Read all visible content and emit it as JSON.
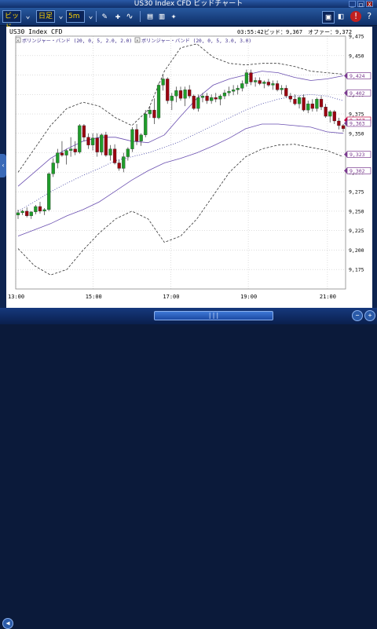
{
  "window": {
    "title": "US30 Index CFD ビッドチャート",
    "minimize": "_",
    "maximize": "□",
    "close": "X"
  },
  "toolbar": {
    "price_type": "ビッド",
    "chart_type": "日足",
    "timeframe": "5m",
    "icons": [
      "pen-icon",
      "pin-icon",
      "magnet-icon",
      "print-icon",
      "bar-chart-icon",
      "sparkle-icon"
    ],
    "right_icons": [
      "monitor-icon",
      "indicator-icon",
      "alert-icon",
      "help-icon"
    ]
  },
  "chart_header": {
    "symbol": "US30 Index CFD",
    "time": "03:55:42",
    "bid_label": "ビッド：9,367",
    "offer_label": "オファー：9,372"
  },
  "indicators": [
    {
      "label": "ボリンジャー・バンド (20, 0, 5, 2.0, 2.0)"
    },
    {
      "label": "ボリンジャー・バンド (20, 0, 5, 3.0, 3.0)"
    }
  ],
  "chart_data": {
    "type": "candlestick",
    "title": "US30 Index CFD",
    "y_ticks": [
      "9,475",
      "9,450",
      "9,425",
      "9,400",
      "9,375",
      "9,350",
      "9,325",
      "9,300",
      "9,275",
      "9,250",
      "9,225",
      "9,200",
      "9,175"
    ],
    "x_ticks": [
      "13:00",
      "15:00",
      "17:00",
      "19:00",
      "21:00"
    ],
    "right_labels": [
      {
        "text": "9,424",
        "color": "#7a3a8f"
      },
      {
        "text": "9,402",
        "color": "#7a3a8f"
      },
      {
        "text": "9,367",
        "color": "#c0003a"
      },
      {
        "text": "9,363",
        "color": "#7a3a8f"
      },
      {
        "text": "9,323",
        "color": "#7a3a8f"
      },
      {
        "text": "9,302",
        "color": "#7a3a8f"
      }
    ],
    "ylim": [
      9150,
      9475
    ],
    "candle_colors": {
      "up": "#1f9c2a",
      "down": "#9a0010"
    },
    "candles": [
      [
        9245,
        9252,
        9240,
        9248
      ],
      [
        9248,
        9252,
        9245,
        9250
      ],
      [
        9250,
        9255,
        9242,
        9244
      ],
      [
        9244,
        9250,
        9240,
        9249
      ],
      [
        9249,
        9258,
        9246,
        9256
      ],
      [
        9256,
        9262,
        9247,
        9250
      ],
      [
        9250,
        9254,
        9245,
        9252
      ],
      [
        9252,
        9300,
        9250,
        9298
      ],
      [
        9298,
        9318,
        9294,
        9312
      ],
      [
        9312,
        9330,
        9305,
        9325
      ],
      [
        9325,
        9340,
        9320,
        9322
      ],
      [
        9322,
        9330,
        9310,
        9328
      ],
      [
        9328,
        9345,
        9320,
        9330
      ],
      [
        9330,
        9340,
        9322,
        9326
      ],
      [
        9326,
        9362,
        9324,
        9360
      ],
      [
        9360,
        9362,
        9340,
        9345
      ],
      [
        9345,
        9350,
        9330,
        9335
      ],
      [
        9335,
        9350,
        9328,
        9344
      ],
      [
        9344,
        9350,
        9320,
        9326
      ],
      [
        9326,
        9350,
        9322,
        9348
      ],
      [
        9348,
        9352,
        9320,
        9322
      ],
      [
        9322,
        9335,
        9315,
        9330
      ],
      [
        9330,
        9336,
        9310,
        9312
      ],
      [
        9312,
        9316,
        9302,
        9305
      ],
      [
        9305,
        9325,
        9300,
        9320
      ],
      [
        9320,
        9332,
        9315,
        9330
      ],
      [
        9330,
        9358,
        9326,
        9355
      ],
      [
        9355,
        9362,
        9335,
        9340
      ],
      [
        9340,
        9350,
        9334,
        9348
      ],
      [
        9348,
        9380,
        9345,
        9375
      ],
      [
        9375,
        9385,
        9370,
        9380
      ],
      [
        9380,
        9395,
        9362,
        9370
      ],
      [
        9370,
        9415,
        9368,
        9412
      ],
      [
        9412,
        9425,
        9405,
        9420
      ],
      [
        9420,
        9422,
        9388,
        9392
      ],
      [
        9392,
        9402,
        9380,
        9398
      ],
      [
        9398,
        9410,
        9390,
        9405
      ],
      [
        9405,
        9410,
        9392,
        9395
      ],
      [
        9395,
        9410,
        9385,
        9406
      ],
      [
        9406,
        9412,
        9395,
        9398
      ],
      [
        9398,
        9400,
        9380,
        9382
      ],
      [
        9382,
        9400,
        9378,
        9396
      ],
      [
        9396,
        9402,
        9390,
        9398
      ],
      [
        9398,
        9402,
        9388,
        9392
      ],
      [
        9392,
        9400,
        9388,
        9396
      ],
      [
        9396,
        9402,
        9390,
        9394
      ],
      [
        9394,
        9400,
        9386,
        9398
      ],
      [
        9398,
        9406,
        9394,
        9402
      ],
      [
        9402,
        9410,
        9398,
        9404
      ],
      [
        9404,
        9412,
        9399,
        9406
      ],
      [
        9406,
        9412,
        9400,
        9408
      ],
      [
        9408,
        9418,
        9404,
        9414
      ],
      [
        9414,
        9432,
        9410,
        9428
      ],
      [
        9428,
        9432,
        9412,
        9416
      ],
      [
        9416,
        9422,
        9410,
        9418
      ],
      [
        9418,
        9422,
        9412,
        9414
      ],
      [
        9414,
        9418,
        9408,
        9416
      ],
      [
        9416,
        9420,
        9410,
        9412
      ],
      [
        9412,
        9418,
        9406,
        9414
      ],
      [
        9414,
        9418,
        9404,
        9406
      ],
      [
        9406,
        9412,
        9400,
        9408
      ],
      [
        9408,
        9412,
        9396,
        9398
      ],
      [
        9398,
        9402,
        9390,
        9394
      ],
      [
        9394,
        9400,
        9386,
        9388
      ],
      [
        9388,
        9398,
        9382,
        9396
      ],
      [
        9396,
        9400,
        9378,
        9380
      ],
      [
        9380,
        9392,
        9376,
        9388
      ],
      [
        9388,
        9394,
        9378,
        9382
      ],
      [
        9382,
        9396,
        9378,
        9394
      ],
      [
        9394,
        9398,
        9380,
        9384
      ],
      [
        9384,
        9388,
        9370,
        9372
      ],
      [
        9372,
        9380,
        9364,
        9378
      ],
      [
        9378,
        9380,
        9362,
        9366
      ],
      [
        9366,
        9370,
        9355,
        9360
      ],
      [
        9360,
        9362,
        9352,
        9356
      ]
    ],
    "bb2_upper": [
      9282,
      9300,
      9318,
      9330,
      9340,
      9345,
      9345,
      9340,
      9338,
      9348,
      9372,
      9395,
      9412,
      9420,
      9425,
      9430,
      9428,
      9422,
      9418,
      9420,
      9424
    ],
    "bb2_mid": [
      9250,
      9262,
      9275,
      9286,
      9296,
      9305,
      9315,
      9320,
      9325,
      9332,
      9340,
      9350,
      9360,
      9370,
      9380,
      9388,
      9394,
      9398,
      9400,
      9398,
      9392
    ],
    "bb2_lower": [
      9218,
      9226,
      9234,
      9244,
      9252,
      9262,
      9276,
      9290,
      9302,
      9312,
      9318,
      9325,
      9334,
      9344,
      9356,
      9362,
      9362,
      9360,
      9358,
      9352,
      9350
    ],
    "bb3_upper": [
      9300,
      9330,
      9360,
      9382,
      9390,
      9385,
      9370,
      9360,
      9380,
      9430,
      9460,
      9465,
      9448,
      9440,
      9438,
      9440,
      9440,
      9436,
      9430,
      9428,
      9426
    ],
    "bb3_lower": [
      9202,
      9180,
      9168,
      9175,
      9200,
      9222,
      9240,
      9250,
      9240,
      9210,
      9218,
      9240,
      9270,
      9300,
      9320,
      9330,
      9335,
      9336,
      9332,
      9328,
      9320
    ]
  },
  "bottom": {
    "scroll_grip": "|||",
    "zoom_out": "−",
    "zoom_in": "+"
  }
}
